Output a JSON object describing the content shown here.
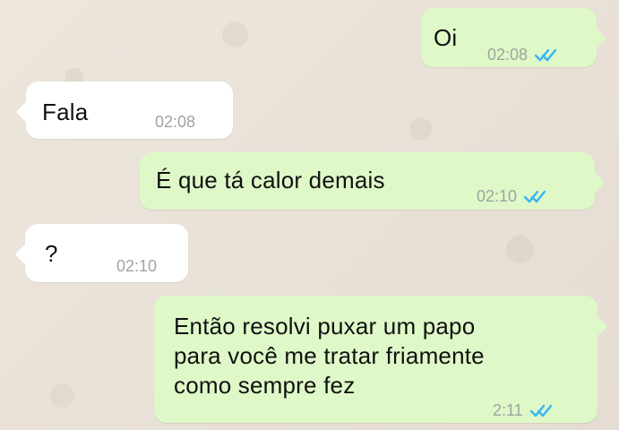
{
  "messages": [
    {
      "text": "Oi",
      "time": "02:08",
      "direction": "outgoing",
      "status_icon": "double-check-icon",
      "status_color": "#34b7f1"
    },
    {
      "text": "Fala",
      "time": "02:08",
      "direction": "incoming"
    },
    {
      "text": "É que tá calor demais",
      "time": "02:10",
      "direction": "outgoing",
      "status_icon": "double-check-icon",
      "status_color": "#34b7f1"
    },
    {
      "text": "?",
      "time": "02:10",
      "direction": "incoming"
    },
    {
      "text": "Então resolvi puxar um papo\npara você me tratar friamente\ncomo sempre fez",
      "time": "2:11",
      "direction": "outgoing",
      "status_icon": "double-check-icon",
      "status_color": "#34b7f1"
    }
  ],
  "colors": {
    "background": "#ece4da",
    "incoming_bubble": "#ffffff",
    "outgoing_bubble": "#dff8c8",
    "meta_text": "#9da4a1"
  }
}
